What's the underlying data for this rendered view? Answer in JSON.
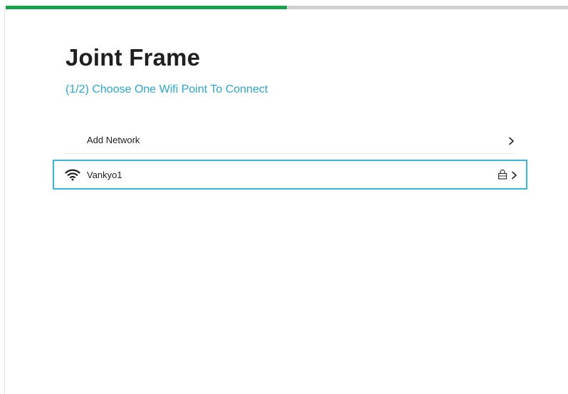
{
  "progress": {
    "fraction": 0.5,
    "fill_color": "#19a04a",
    "track_color": "#cfcfcf"
  },
  "header": {
    "title": "Joint Frame",
    "subtitle": "(1/2) Choose One Wifi Point To Connect",
    "subtitle_color": "#2aa6d4"
  },
  "networks": {
    "add_network": {
      "label": "Add Network",
      "icon": "chevron-right-icon"
    },
    "items": [
      {
        "ssid": "Vankyo1",
        "signal_icon": "wifi-icon",
        "secured": true,
        "lock_icon": "lock-icon",
        "chevron_icon": "chevron-right-icon",
        "selected": true
      }
    ]
  },
  "accent_color": "#38b7dc"
}
